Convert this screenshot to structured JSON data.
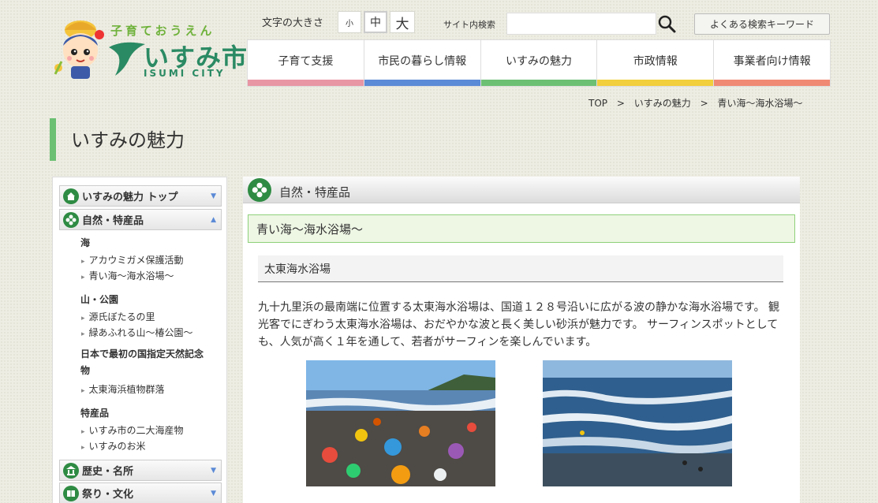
{
  "header": {
    "logo_sub": "子育ておうえん",
    "logo_main": "いすみ市",
    "logo_en": "ISUMI CITY",
    "fontsize_label": "文字の大きさ",
    "fontsize_small": "小",
    "fontsize_medium": "中",
    "fontsize_large": "大",
    "search_label": "サイト内検索",
    "search_value": "",
    "keyword_button": "よくある検索キーワード"
  },
  "gnav": [
    {
      "label": "子育て支援",
      "color": "#e896a4"
    },
    {
      "label": "市民の暮らし情報",
      "color": "#5b8ad6"
    },
    {
      "label": "いすみの魅力",
      "color": "#6cc073"
    },
    {
      "label": "市政情報",
      "color": "#f2cf3c"
    },
    {
      "label": "事業者向け情報",
      "color": "#f08a74"
    }
  ],
  "breadcrumb": {
    "top": "TOP",
    "sep": ">",
    "level1": "いすみの魅力",
    "level2": "青い海～海水浴場～"
  },
  "page_title": "いすみの魅力",
  "sidebar": {
    "head_top": "いすみの魅力 トップ",
    "head_nature": "自然・特産品",
    "cat_sea": "海",
    "link_turtle": "アカウミガメ保護活動",
    "link_beach": "青い海～海水浴場～",
    "cat_mountain": "山・公園",
    "link_firefly": "源氏ぼたるの里",
    "link_tsubaki": "緑あふれる山～椿公園～",
    "cat_monument": "日本で最初の国指定天然記念物",
    "link_plants": "太東海浜植物群落",
    "cat_products": "特産品",
    "link_seafood": "いすみ市の二大海産物",
    "link_rice": "いすみのお米",
    "head_history": "歴史・名所",
    "head_festival": "祭り・文化"
  },
  "main": {
    "section_title": "自然・特産品",
    "page_heading": "青い海～海水浴場～",
    "article_heading": "太東海水浴場",
    "article_text": "九十九里浜の最南端に位置する太東海水浴場は、国道１２８号沿いに広がる波の静かな海水浴場です。 観光客でにぎわう太東海水浴場は、おだやかな波と長く美しい砂浜が魅力です。 サーフィンスポットとしても、人気が高く１年を通して、若者がサーフィンを楽しんでいます。"
  },
  "colors": {
    "accent_green": "#6cc073",
    "icon_green": "#2e8b43",
    "logo_green": "#2a8a63"
  }
}
